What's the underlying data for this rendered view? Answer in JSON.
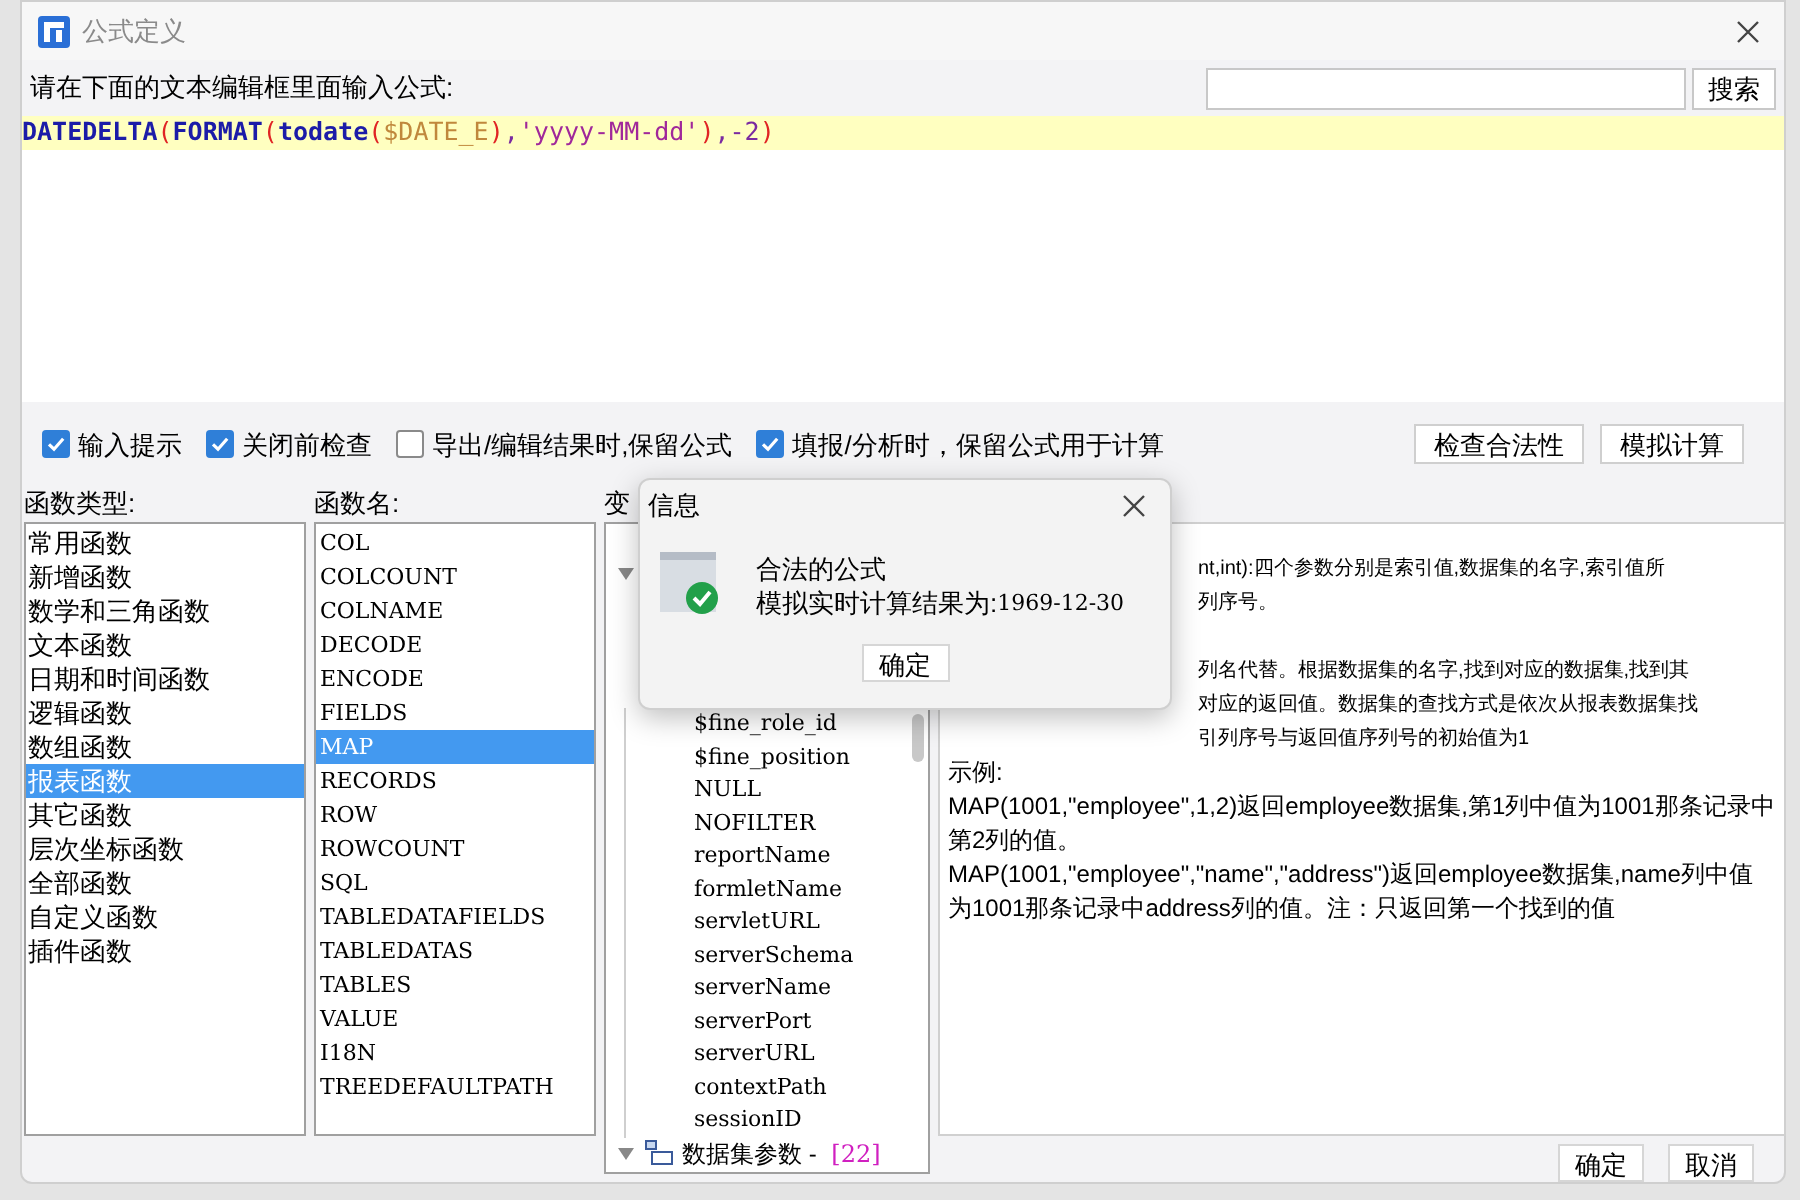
{
  "window": {
    "title": "公式定义"
  },
  "prompt": "请在下面的文本编辑框里面输入公式:",
  "search": {
    "button": "搜索"
  },
  "formula": [
    {
      "text": "DATEDELTA",
      "kind": "func"
    },
    {
      "text": "(",
      "kind": "paren"
    },
    {
      "text": "FORMAT",
      "kind": "func"
    },
    {
      "text": "(",
      "kind": "paren"
    },
    {
      "text": "todate",
      "kind": "func"
    },
    {
      "text": "(",
      "kind": "paren"
    },
    {
      "text": "$DATE_E",
      "kind": "variable"
    },
    {
      "text": ")",
      "kind": "paren"
    },
    {
      "text": ",",
      "kind": "punct"
    },
    {
      "text": "'yyyy-MM-dd'",
      "kind": "string"
    },
    {
      "text": ")",
      "kind": "paren"
    },
    {
      "text": ",-2",
      "kind": "punct"
    },
    {
      "text": ")",
      "kind": "paren"
    }
  ],
  "options": [
    {
      "label": "输入提示",
      "checked": true
    },
    {
      "label": "关闭前检查",
      "checked": true
    },
    {
      "label": "导出/编辑结果时,保留公式",
      "checked": false
    },
    {
      "label": "填报/分析时，保留公式用于计算",
      "checked": true
    }
  ],
  "action_buttons": [
    "检查合法性",
    "模拟计算"
  ],
  "function_types": {
    "title": "函数类型:",
    "items": [
      {
        "label": "常用函数",
        "selected": false
      },
      {
        "label": "新增函数",
        "selected": false
      },
      {
        "label": "数学和三角函数",
        "selected": false
      },
      {
        "label": "文本函数",
        "selected": false
      },
      {
        "label": "日期和时间函数",
        "selected": false
      },
      {
        "label": "逻辑函数",
        "selected": false
      },
      {
        "label": "数组函数",
        "selected": false
      },
      {
        "label": "报表函数",
        "selected": true
      },
      {
        "label": "其它函数",
        "selected": false
      },
      {
        "label": "层次坐标函数",
        "selected": false
      },
      {
        "label": "全部函数",
        "selected": false
      },
      {
        "label": "自定义函数",
        "selected": false
      },
      {
        "label": "插件函数",
        "selected": false
      }
    ]
  },
  "function_names": {
    "title": "函数名:",
    "items": [
      {
        "label": "COL",
        "selected": false
      },
      {
        "label": "COLCOUNT",
        "selected": false
      },
      {
        "label": "COLNAME",
        "selected": false
      },
      {
        "label": "DECODE",
        "selected": false
      },
      {
        "label": "ENCODE",
        "selected": false
      },
      {
        "label": "FIELDS",
        "selected": false
      },
      {
        "label": "MAP",
        "selected": true
      },
      {
        "label": "RECORDS",
        "selected": false
      },
      {
        "label": "ROW",
        "selected": false
      },
      {
        "label": "ROWCOUNT",
        "selected": false
      },
      {
        "label": "SQL",
        "selected": false
      },
      {
        "label": "TABLEDATAFIELDS",
        "selected": false
      },
      {
        "label": "TABLEDATAS",
        "selected": false
      },
      {
        "label": "TABLES",
        "selected": false
      },
      {
        "label": "VALUE",
        "selected": false
      },
      {
        "label": "I18N",
        "selected": false
      },
      {
        "label": "TREEDEFAULTPATH",
        "selected": false
      }
    ]
  },
  "variables": {
    "title": "变",
    "items": [
      "$fine_role_id",
      "$fine_position",
      "NULL",
      "NOFILTER",
      "reportName",
      "formletName",
      "servletURL",
      "serverSchema",
      "serverName",
      "serverPort",
      "serverURL",
      "contextPath",
      "sessionID"
    ],
    "group": {
      "label": "数据集参数 - ",
      "count": "[22]"
    }
  },
  "description": {
    "lines": [
      {
        "text": "nt,int):四个参数分别是索引值,数据集的名字,索引值所",
        "kind": "clipped"
      },
      {
        "text": "列序号。",
        "kind": "clipped"
      },
      {
        "text": "列名代替。根据数据集的名字,找到对应的数据集,找到其",
        "kind": "clipped"
      },
      {
        "text": "对应的返回值。数据集的查找方式是依次从报表数据集找",
        "kind": "clipped"
      },
      {
        "text": "引列序号与返回值序列号的初始值为1",
        "kind": "clipped"
      },
      {
        "text": "示例:",
        "kind": "full"
      },
      {
        "text": "MAP(1001,\"employee\",1,2)返回employee数据集,第1列中值为1001那条记录中",
        "kind": "full"
      },
      {
        "text": "第2列的值。",
        "kind": "full"
      },
      {
        "text": "MAP(1001,\"employee\",\"name\",\"address\")返回employee数据集,name列中值",
        "kind": "full"
      },
      {
        "text": "为1001那条记录中address列的值。注：只返回第一个找到的值",
        "kind": "full"
      }
    ]
  },
  "dialog_buttons": [
    "确定",
    "取消"
  ],
  "info_dialog": {
    "title": "信息",
    "message": "合法的公式",
    "result_label": "模拟实时计算结果为:",
    "result": "1969-12-30",
    "button": "确定"
  }
}
